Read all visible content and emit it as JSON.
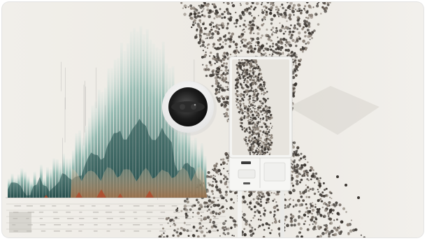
{
  "scene": {
    "alt": "",
    "colors": {
      "background": "#ece9e4",
      "paper": "#efece7",
      "teal_dark": "#1f4a48",
      "teal_mid": "#3f7f78",
      "teal_light": "#8fb9ae",
      "rust": "#b24a2c",
      "sand": "#c9a27a",
      "crowd_dark": "#3a3530",
      "crowd_light": "#8b8177",
      "kiosk_white": "#f5f5f3",
      "camera_ring": "#ffffff",
      "camera_lens": "#222222"
    },
    "icons": [
      "camera-lens-icon"
    ]
  }
}
